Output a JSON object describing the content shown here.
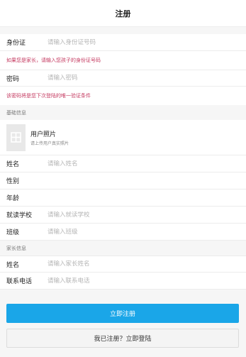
{
  "header": {
    "title": "注册"
  },
  "id_card": {
    "label": "身份证",
    "placeholder": "请输入身份证号码",
    "hint": "如果您是家长，请输入您孩子的身份证号码"
  },
  "password": {
    "label": "密码",
    "placeholder": "请输入密码",
    "hint": "该密码将是您下次登陆的唯一验证条件"
  },
  "basic_section": {
    "title": "基础信息"
  },
  "photo": {
    "title": "用户照片",
    "subtitle": "请上传用户真实照片",
    "icon": "image-placeholder-icon"
  },
  "name": {
    "label": "姓名",
    "placeholder": "请输入姓名"
  },
  "gender": {
    "label": "性别"
  },
  "age": {
    "label": "年龄"
  },
  "school": {
    "label": "就读学校",
    "placeholder": "请输入就读学校"
  },
  "class": {
    "label": "班级",
    "placeholder": "请输入班级"
  },
  "parent_section": {
    "title": "家长信息"
  },
  "parent_name": {
    "label": "姓名",
    "placeholder": "请输入家长姓名"
  },
  "phone": {
    "label": "联系电话",
    "placeholder": "请输入联系电话"
  },
  "buttons": {
    "register": "立即注册",
    "login": "我已注册？立即登陆"
  },
  "colors": {
    "primary": "#1aa6e8",
    "hint": "#c4385f"
  }
}
